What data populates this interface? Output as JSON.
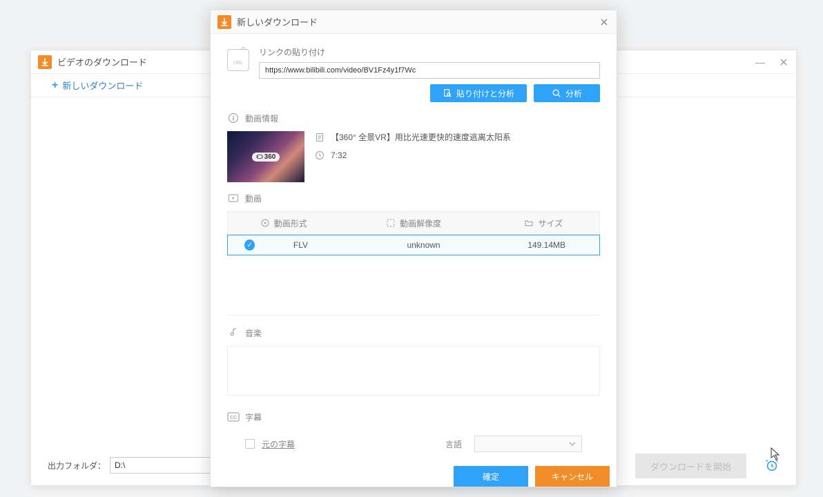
{
  "mainWindow": {
    "title": "ビデオのダウンロード",
    "newDownload": "新しいダウンロード",
    "outputFolderLabel": "出力フォルダ：",
    "outputFolderValue": "D:\\",
    "startDownload": "ダウンロードを開始"
  },
  "modal": {
    "title": "新しいダウンロード",
    "linkPasteLabel": "リンクの貼り付け",
    "urlValue": "https://www.bilibili.com/video/BV1Fz4y1f7Wc",
    "pasteAnalyze": "貼り付けと分析",
    "analyze": "分析",
    "videoInfoHead": "動画情報",
    "videoTitle": "【360°  全景VR】用比光速更快的速度逃离太阳系",
    "videoDuration": "7:32",
    "thumbBadge": "360",
    "videoSectionHead": "動画",
    "col": {
      "format": "動画形式",
      "resolution": "動画解像度",
      "size": "サイズ"
    },
    "row": {
      "format": "FLV",
      "resolution": "unknown",
      "size": "149.14MB"
    },
    "musicHead": "音楽",
    "subtitleHead": "字幕",
    "originalSubtitle": "元の字幕",
    "languageLabel": "言語",
    "ok": "確定",
    "cancel": "キャンセル"
  },
  "icons": {
    "urlIcon": "URL"
  }
}
